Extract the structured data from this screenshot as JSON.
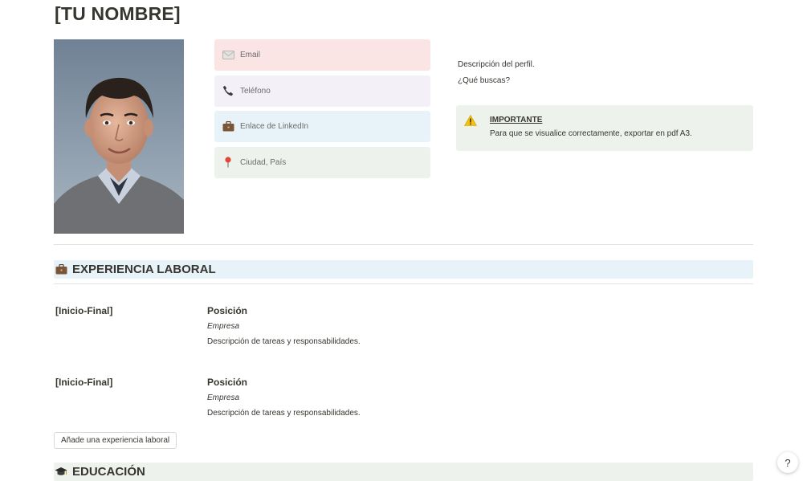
{
  "title": "[TU NOMBRE]",
  "contacts": [
    {
      "label": "Email",
      "icon": "envelope-icon",
      "bg": "#fbe4e4"
    },
    {
      "label": "Teléfono",
      "icon": "phone-icon",
      "bg": "#f4f0f7"
    },
    {
      "label": "Enlace de LinkedIn",
      "icon": "briefcase-icon",
      "bg": "#e7f3f8"
    },
    {
      "label": "Ciudad, País",
      "icon": "pin-icon",
      "bg": "#edf3ec"
    }
  ],
  "profile": {
    "description": "Descripción del perfil.",
    "seeking": "¿Qué buscas?"
  },
  "callout": {
    "icon": "warning-icon",
    "title": "IMPORTANTE",
    "body": "Para que se visualice correctamente, exportar en pdf A3.",
    "bg": "#edf3ec"
  },
  "experience": {
    "icon": "briefcase-icon",
    "heading": "EXPERIENCIA LABORAL",
    "heading_bg": "#e7f3f8",
    "items": [
      {
        "dates": "[Inicio-Final]",
        "position": "Posición",
        "company": "Empresa",
        "description": "Descripción de tareas y responsabilidades."
      },
      {
        "dates": "[Inicio-Final]",
        "position": "Posición",
        "company": "Empresa",
        "description": "Descripción de tareas y responsabilidades."
      }
    ],
    "add_label": "Añade una experiencia laboral"
  },
  "education": {
    "icon": "graduation-cap-icon",
    "heading": "EDUCACIÓN",
    "heading_bg": "#edf3ec"
  },
  "help_label": "?"
}
